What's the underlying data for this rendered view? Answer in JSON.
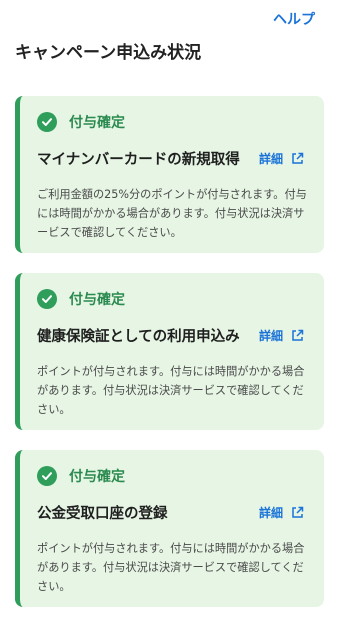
{
  "header": {
    "help_label": "ヘルプ",
    "title": "キャンペーン申込み状況"
  },
  "cards": [
    {
      "status": "付与確定",
      "title": "マイナンバーカードの新規取得",
      "detail_label": "詳細",
      "description": "ご利用金額の25%分のポイントが付与されます。付与には時間がかかる場合があります。付与状況は決済サービスで確認してください。"
    },
    {
      "status": "付与確定",
      "title": "健康保険証としての利用申込み",
      "detail_label": "詳細",
      "description": "ポイントが付与されます。付与には時間がかかる場合があります。付与状況は決済サービスで確認してください。"
    },
    {
      "status": "付与確定",
      "title": "公金受取口座の登録",
      "detail_label": "詳細",
      "description": "ポイントが付与されます。付与には時間がかかる場合があります。付与状況は決済サービスで確認してください。"
    }
  ],
  "icons": {
    "status": "check-circle-icon",
    "detail": "external-link-icon"
  },
  "colors": {
    "accent_green": "#2f9e5a",
    "card_background": "#e6f5e4",
    "link_blue": "#1a73d9"
  }
}
